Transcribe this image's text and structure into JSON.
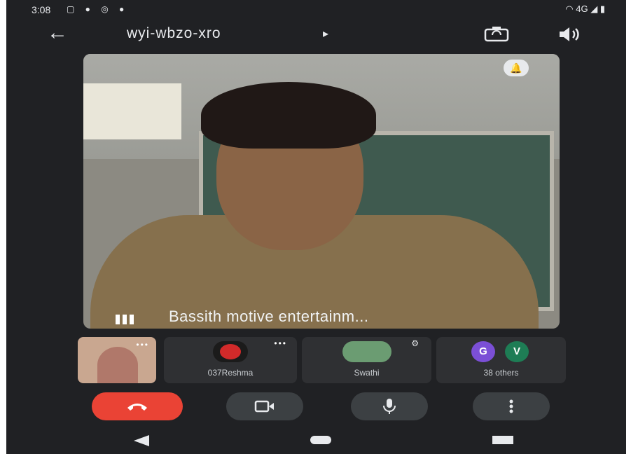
{
  "status_bar": {
    "time": "3:08",
    "network": "4G"
  },
  "header": {
    "meeting_code": "wyi-wbzo-xro",
    "back_icon": "arrow-left-icon",
    "switch_camera_icon": "camera-switch-icon",
    "speaker_icon": "speaker-icon"
  },
  "main_video": {
    "caption": "Bassith motive entertainm..."
  },
  "participants": [
    {
      "name": ""
    },
    {
      "name": "037Reshma"
    },
    {
      "name": "Swathi"
    },
    {
      "name": "38 others",
      "initials": [
        "G",
        "V"
      ]
    }
  ],
  "controls": {
    "end_call_icon": "phone-hangup-icon",
    "camera_icon": "video-camera-icon",
    "mic_icon": "microphone-icon",
    "more_icon": "more-vertical-icon"
  },
  "colors": {
    "end_call": "#ea4335",
    "background": "#202124",
    "control_bg": "#3c4043",
    "avatar_g": "#7b4fd6",
    "avatar_v": "#1e7d55"
  }
}
